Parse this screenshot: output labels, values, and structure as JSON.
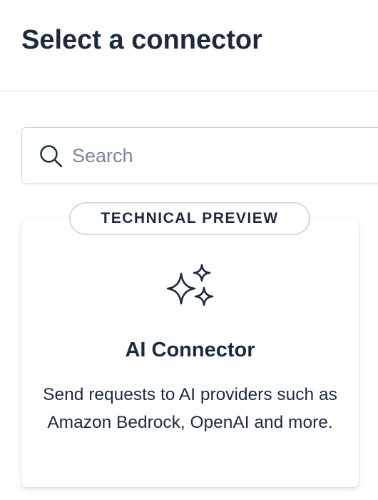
{
  "header": {
    "title": "Select a connector"
  },
  "search": {
    "placeholder": "Search",
    "value": "",
    "icon": "search-icon"
  },
  "connectors": [
    {
      "badge": "TECHNICAL PREVIEW",
      "icon": "sparkles-icon",
      "title": "AI Connector",
      "description": "Send requests to AI providers such as Amazon Bedrock, OpenAI and more."
    }
  ],
  "colors": {
    "text": "#1d2a3e",
    "placeholder": "#7a869c",
    "border": "#cad3e2",
    "divider": "#e3e8f2"
  }
}
